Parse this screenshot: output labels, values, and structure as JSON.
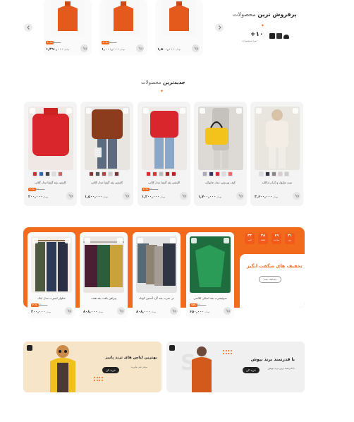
{
  "colors": {
    "accent": "#f26b1d",
    "banner_left": "#f6e5c8",
    "banner_right": "#f0f0f0"
  },
  "best_sellers": {
    "title_bold": "پرفروش ترین",
    "title_light": "محصولات",
    "count": "+۱۰",
    "count_label": "تنوع محصولات",
    "nav_prev_icon": "chevron-left-icon",
    "nav_next_icon": "chevron-right-icon",
    "products": [
      {
        "old": "۶۵۰,۰۰۰",
        "badge": "۲۰%",
        "price": "۱,۴۹۰,۰۰۰",
        "unit": "تومان"
      },
      {
        "old": "۶۵۰,۰۰۰",
        "badge": "۲۰%",
        "price": "۱,۰۰۰,۰۰۰",
        "unit": "تومان"
      },
      {
        "old": "",
        "badge": "",
        "price": "۱,۵۰۰,۰۰۰",
        "unit": "تومان"
      }
    ]
  },
  "newest": {
    "title_bold": "جدیدترین",
    "title_light": "محصولات",
    "products": [
      {
        "name": "ست شلوار و کراپ ژاکارد",
        "old": "",
        "badge": "",
        "price": "۳,۶۰۰,۰۰۰",
        "unit": "تومان"
      },
      {
        "name": "کیف ورزشی مدل چانوکن",
        "old": "",
        "badge": "",
        "price": "۱,۷۰۰,۰۰۰",
        "unit": "تومان"
      },
      {
        "name": "کاپشن یقه گیشا مدل کلاتی",
        "old": "۶۵۰,۰۰۰",
        "badge": "۲۰%",
        "price": "۱,۲۰۰,۰۰۰",
        "unit": "تومان"
      },
      {
        "name": "کاپشن یقه گیشا مدل کلاتی",
        "old": "",
        "badge": "",
        "price": "۱,۵۰۰,۰۰۰",
        "unit": "تومان"
      },
      {
        "name": "کاپشن یقه گیشا مدل کلاتی",
        "old": "۶۵۰,۰۰۰",
        "badge": "۲۰%",
        "price": "۲۰۰,۰۰۰",
        "unit": "تومان"
      }
    ]
  },
  "discount": {
    "title": "تخفیف های شگفت انگیز",
    "view_all": "مشاهده همه",
    "timer": [
      {
        "n": "۲۱",
        "l": "روز"
      },
      {
        "n": "۱۹",
        "l": "ساعت"
      },
      {
        "n": "۴۸",
        "l": "دقیقه"
      },
      {
        "n": "۳۳",
        "l": "ثانیه"
      }
    ],
    "products": [
      {
        "name": "سوئیشرت یقه اسکی کلاسی",
        "old": "۶۵۰,۰۰۰",
        "badge": "۱۵%",
        "price": "۶۵۰,۰۰۰",
        "unit": "تومان"
      },
      {
        "name": "تی شرت یقه گرد آستین کوتاه",
        "old": "",
        "badge": "",
        "price": "۸۰۸,۰۰۰",
        "unit": "تومان"
      },
      {
        "name": "پیراهن بافت یقه هفت",
        "old": "",
        "badge": "",
        "price": "۸۰۸,۰۰۰",
        "unit": "تومان"
      },
      {
        "name": "شلوار اسپرت مدل اینک",
        "old": "۶۵۰,۰۰۰",
        "badge": "۲۰%",
        "price": "۳۰۰,۰۰۰",
        "unit": "تومان"
      }
    ]
  },
  "banners": [
    {
      "title": "با قدرتمند برند بپوش",
      "sub": "با قدرتمند ترین برند بپوش",
      "btn": "خرید کن"
    },
    {
      "title": "بهترین لباس های ترند پاییز",
      "sub": "سحر نفر بیاورید",
      "btn": "خرید کن"
    }
  ]
}
